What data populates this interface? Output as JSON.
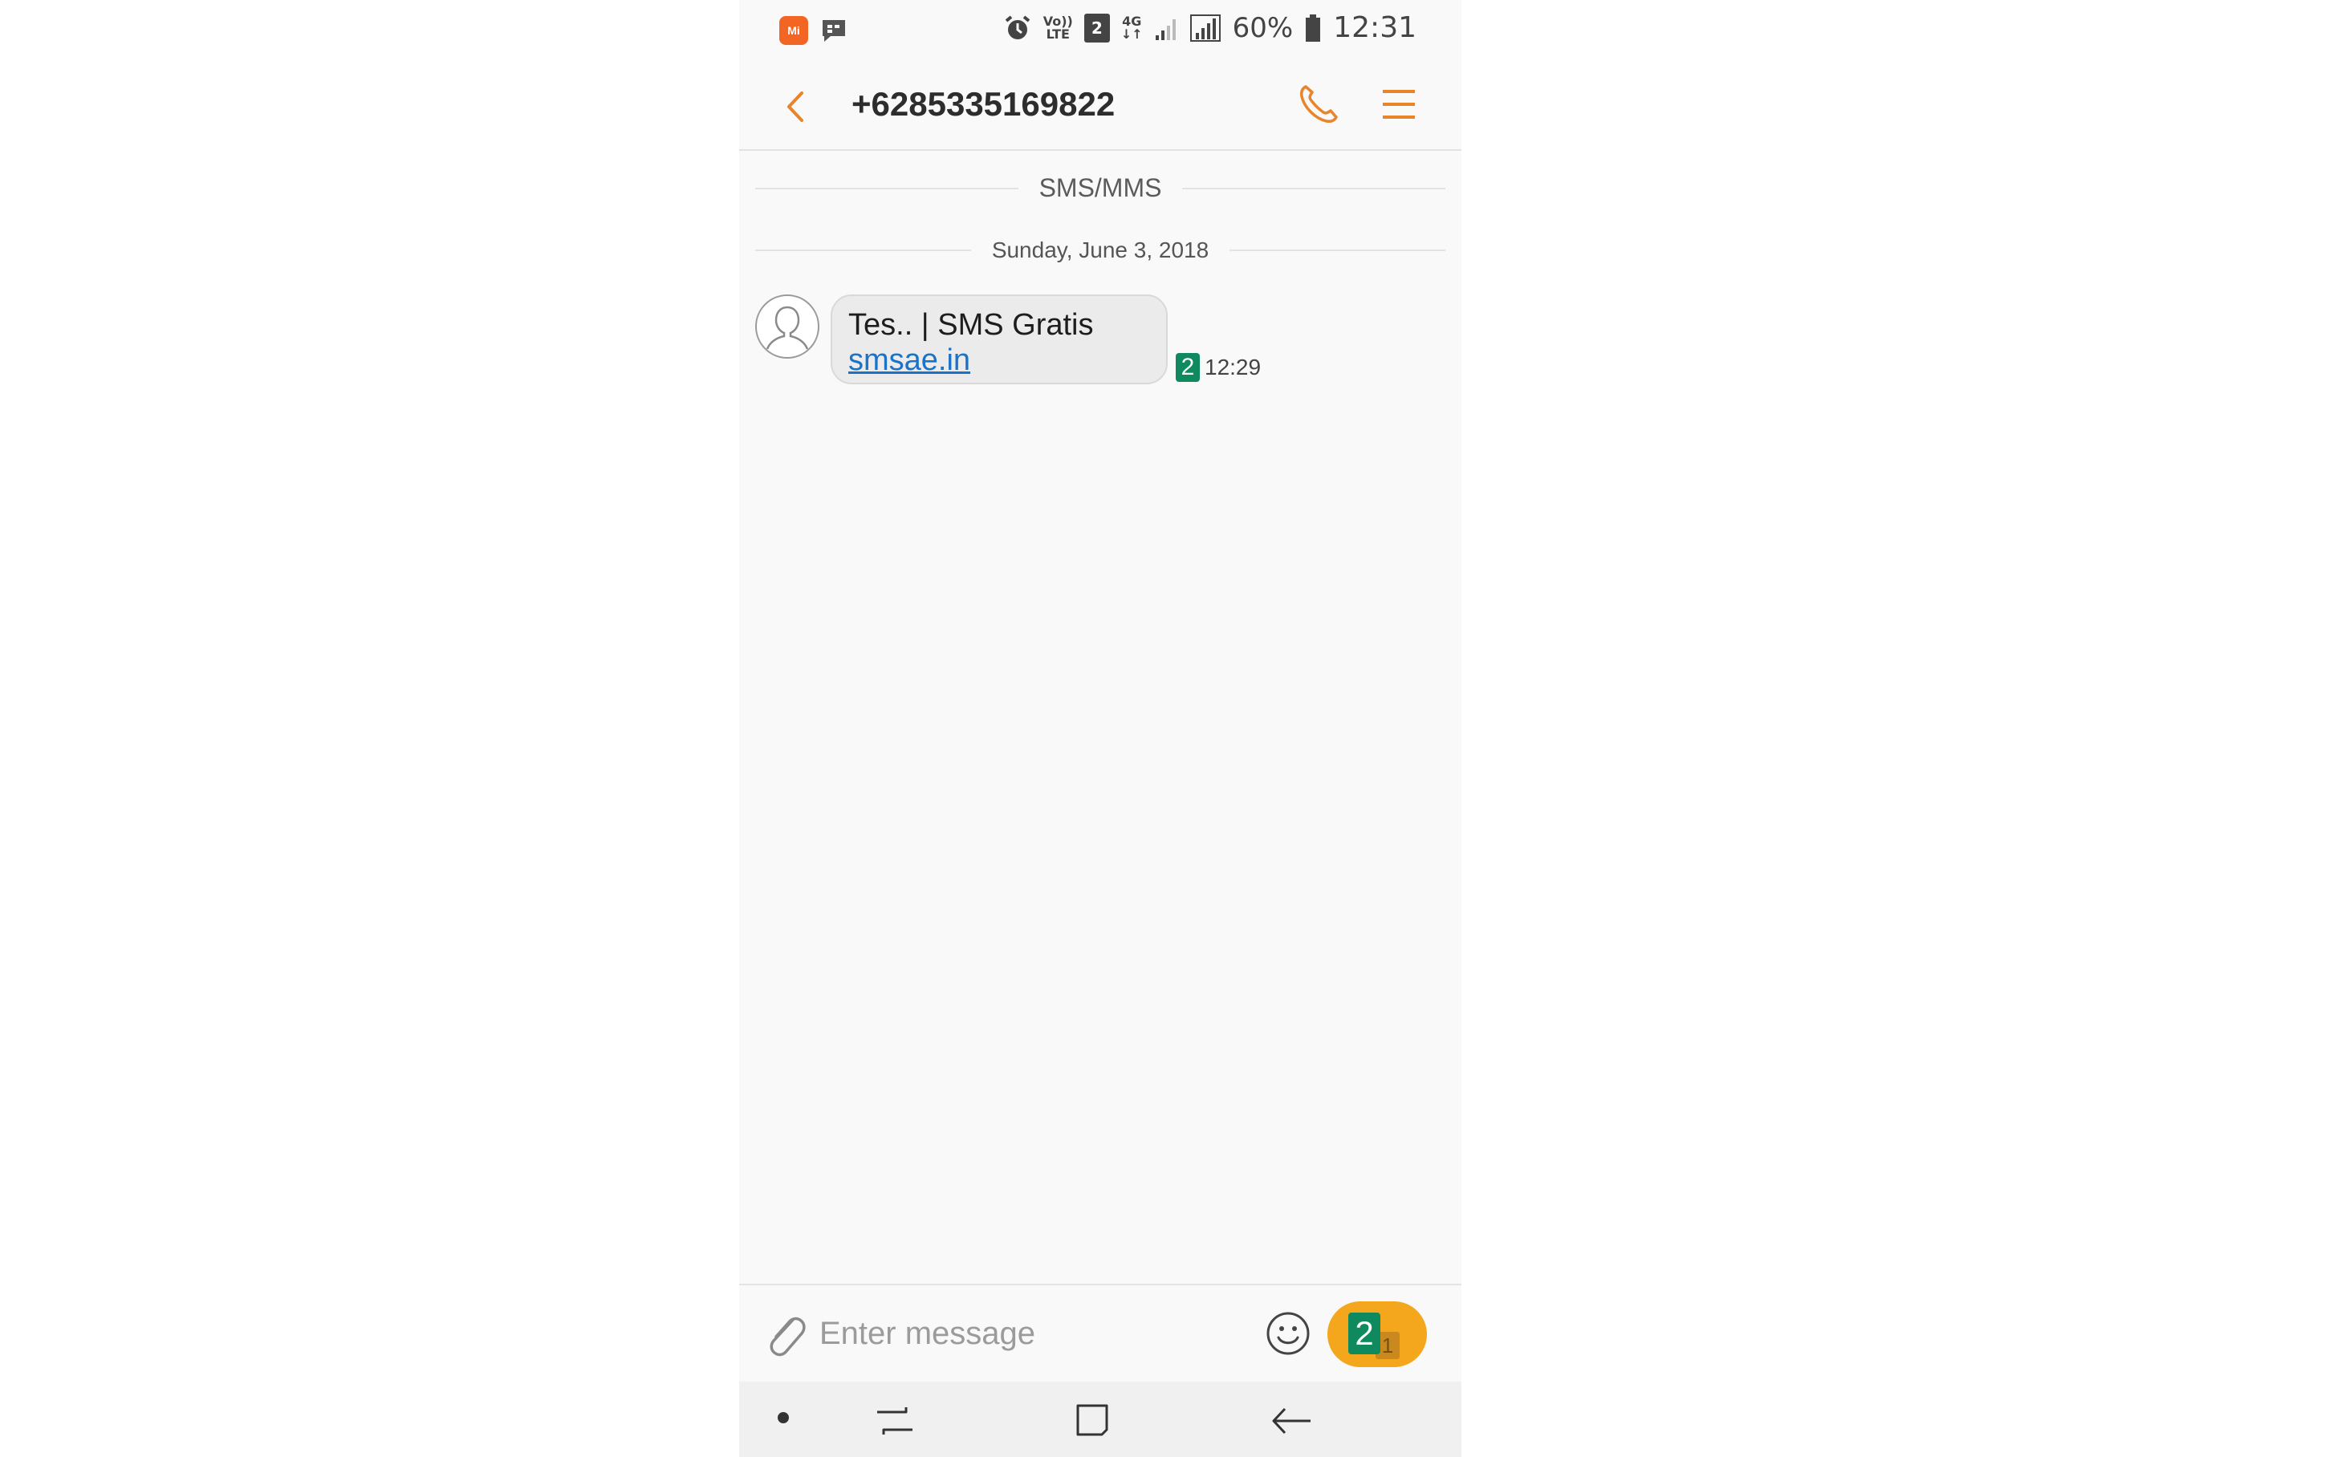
{
  "status_bar": {
    "app_icon_label": "Mi",
    "sim_slot": "2",
    "network_type": "4G",
    "volte_label_top": "Vo))",
    "volte_label_bottom": "LTE",
    "battery_percent": "60%",
    "time": "12:31"
  },
  "header": {
    "contact": "+6285335169822",
    "icons": [
      "back-icon",
      "phone-icon",
      "menu-icon"
    ]
  },
  "conversation": {
    "channel_label": "SMS/MMS",
    "date_label": "Sunday, June 3, 2018",
    "messages": [
      {
        "text": "Tes.. | SMS Gratis",
        "link": "smsae.in",
        "sim": "2",
        "time": "12:29"
      }
    ]
  },
  "composer": {
    "placeholder": "Enter message",
    "send_sim_main": "2",
    "send_sim_sub": "1"
  },
  "colors": {
    "accent": "#e8842a",
    "send_button": "#f4a71c",
    "sim_green": "#0f8a5f",
    "link": "#1a73c8"
  }
}
